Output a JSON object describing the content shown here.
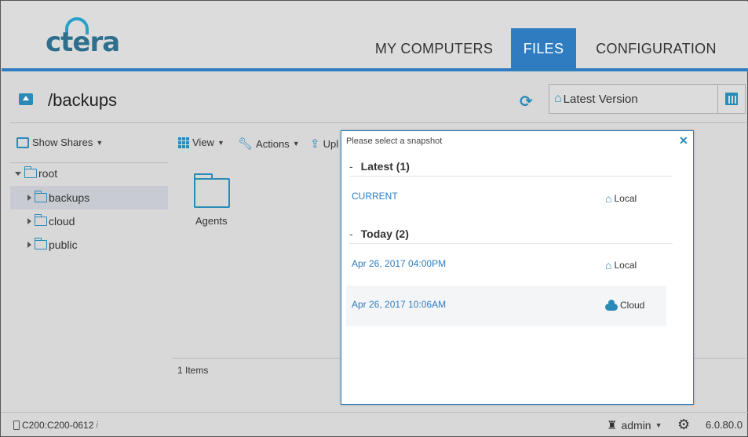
{
  "header": {
    "logo_text": "ctera",
    "tabs": [
      {
        "label": "MY COMPUTERS"
      },
      {
        "label": "FILES"
      },
      {
        "label": "CONFIGURATION"
      }
    ],
    "active_tab": "FILES"
  },
  "pathbar": {
    "path": "/backups",
    "version_label": "Latest Version"
  },
  "sidebar": {
    "show_shares_label": "Show Shares",
    "tree": [
      {
        "label": "root"
      },
      {
        "label": "backups"
      },
      {
        "label": "cloud"
      },
      {
        "label": "public"
      }
    ],
    "selected": "backups"
  },
  "toolbar": {
    "view_label": "View",
    "actions_label": "Actions",
    "upload_label": "Upl"
  },
  "content": {
    "folders": [
      {
        "label": "Agents"
      }
    ],
    "items_count": "1 Items"
  },
  "footer": {
    "device": "C200:C200-0612",
    "user": "admin",
    "version": "6.0.80.0"
  },
  "snapshot_dialog": {
    "title": "Please select a snapshot",
    "groups": [
      {
        "dash": "-",
        "label": "Latest (1)",
        "items": [
          {
            "label": "CURRENT",
            "location": "Local",
            "location_icon": "house-icon"
          }
        ]
      },
      {
        "dash": "-",
        "label": "Today (2)",
        "items": [
          {
            "label": "Apr 26, 2017 04:00PM",
            "location": "Local",
            "location_icon": "house-icon"
          },
          {
            "label": "Apr 26, 2017 10:06AM",
            "location": "Cloud",
            "location_icon": "cloud-icon"
          }
        ]
      }
    ]
  },
  "colors": {
    "accent": "#2f7dc0",
    "icon": "#2a8ab8",
    "background": "#d8d8d8"
  }
}
